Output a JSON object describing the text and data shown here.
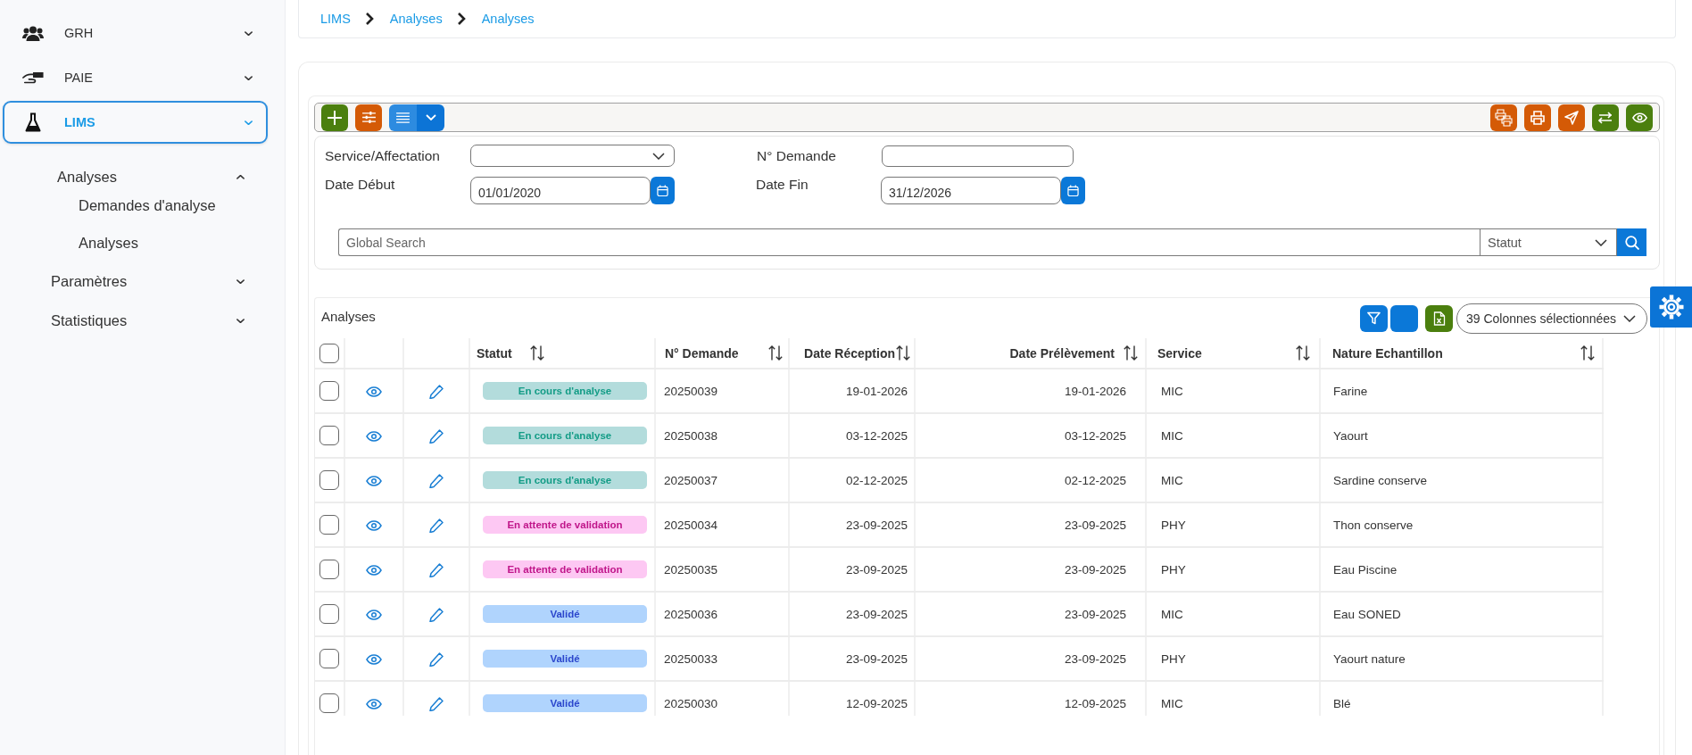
{
  "sidebar": {
    "items": [
      {
        "label": "GRH",
        "selected": false,
        "expanded": false
      },
      {
        "label": "PAIE",
        "selected": false,
        "expanded": false
      },
      {
        "label": "LIMS",
        "selected": true,
        "expanded": false,
        "children": [
          {
            "label": "Analyses",
            "selected": false,
            "expanded": true,
            "children": [
              {
                "label": "Demandes d'analyse",
                "selected": false
              },
              {
                "label": "Analyses",
                "selected": false
              }
            ]
          },
          {
            "label": "Paramètres",
            "selected": false,
            "expanded": false
          },
          {
            "label": "Statistiques",
            "selected": false,
            "expanded": false
          }
        ]
      }
    ]
  },
  "breadcrumb": {
    "items": [
      "LIMS",
      "Analyses",
      "Analyses"
    ]
  },
  "filters": {
    "service": {
      "label": "Service/Affectation"
    },
    "request_no": {
      "label": "N° Demande"
    },
    "date_start": {
      "label": "Date Début",
      "value": "01/01/2020"
    },
    "date_end": {
      "label": "Date Fin",
      "value": "31/12/2026"
    },
    "search": {
      "placeholder": "Global Search"
    },
    "status": {
      "placeholder": "Statut"
    }
  },
  "table": {
    "title": "Analyses",
    "columns_select": {
      "value": "39 Colonnes sélectionnées"
    },
    "header_checked": false,
    "columns": [
      "Statut",
      "N° Demande",
      "Date Réception",
      "Date Prélèvement",
      "Service",
      "Nature Echantillon"
    ],
    "rows": [
      {
        "checked": false,
        "cells": [
          {
            "label": "En cours d'analyse",
            "kind": "in_progress",
            "color": "#b3dcdc"
          },
          "20250039",
          "19-01-2026",
          "19-01-2026",
          "MIC",
          "Farine"
        ]
      },
      {
        "checked": false,
        "cells": [
          {
            "label": "En cours d'analyse",
            "kind": "in_progress",
            "color": "#b3dcdc"
          },
          "20250038",
          "03-12-2025",
          "03-12-2025",
          "MIC",
          "Yaourt"
        ]
      },
      {
        "checked": false,
        "cells": [
          {
            "label": "En cours d'analyse",
            "kind": "in_progress",
            "color": "#b3dcdc"
          },
          "20250037",
          "02-12-2025",
          "02-12-2025",
          "MIC",
          "Sardine conserve"
        ]
      },
      {
        "checked": false,
        "cells": [
          {
            "label": "En attente de validation",
            "kind": "pending",
            "color": "#fdc8f3"
          },
          "20250034",
          "23-09-2025",
          "23-09-2025",
          "PHY",
          "Thon conserve"
        ]
      },
      {
        "checked": false,
        "cells": [
          {
            "label": "En attente de validation",
            "kind": "pending",
            "color": "#fdc8f3"
          },
          "20250035",
          "23-09-2025",
          "23-09-2025",
          "PHY",
          "Eau Piscine"
        ]
      },
      {
        "checked": false,
        "cells": [
          {
            "label": "Validé",
            "kind": "validated",
            "color": "#b0d4fd"
          },
          "20250036",
          "23-09-2025",
          "23-09-2025",
          "MIC",
          "Eau SONED"
        ]
      },
      {
        "checked": false,
        "cells": [
          {
            "label": "Validé",
            "kind": "validated",
            "color": "#b0d4fd"
          },
          "20250033",
          "23-09-2025",
          "23-09-2025",
          "PHY",
          "Yaourt nature"
        ]
      },
      {
        "checked": false,
        "cells": [
          {
            "label": "Validé",
            "kind": "validated",
            "color": "#b0d4fd"
          },
          "20250030",
          "12-09-2025",
          "12-09-2025",
          "MIC",
          "Blé"
        ]
      }
    ]
  }
}
